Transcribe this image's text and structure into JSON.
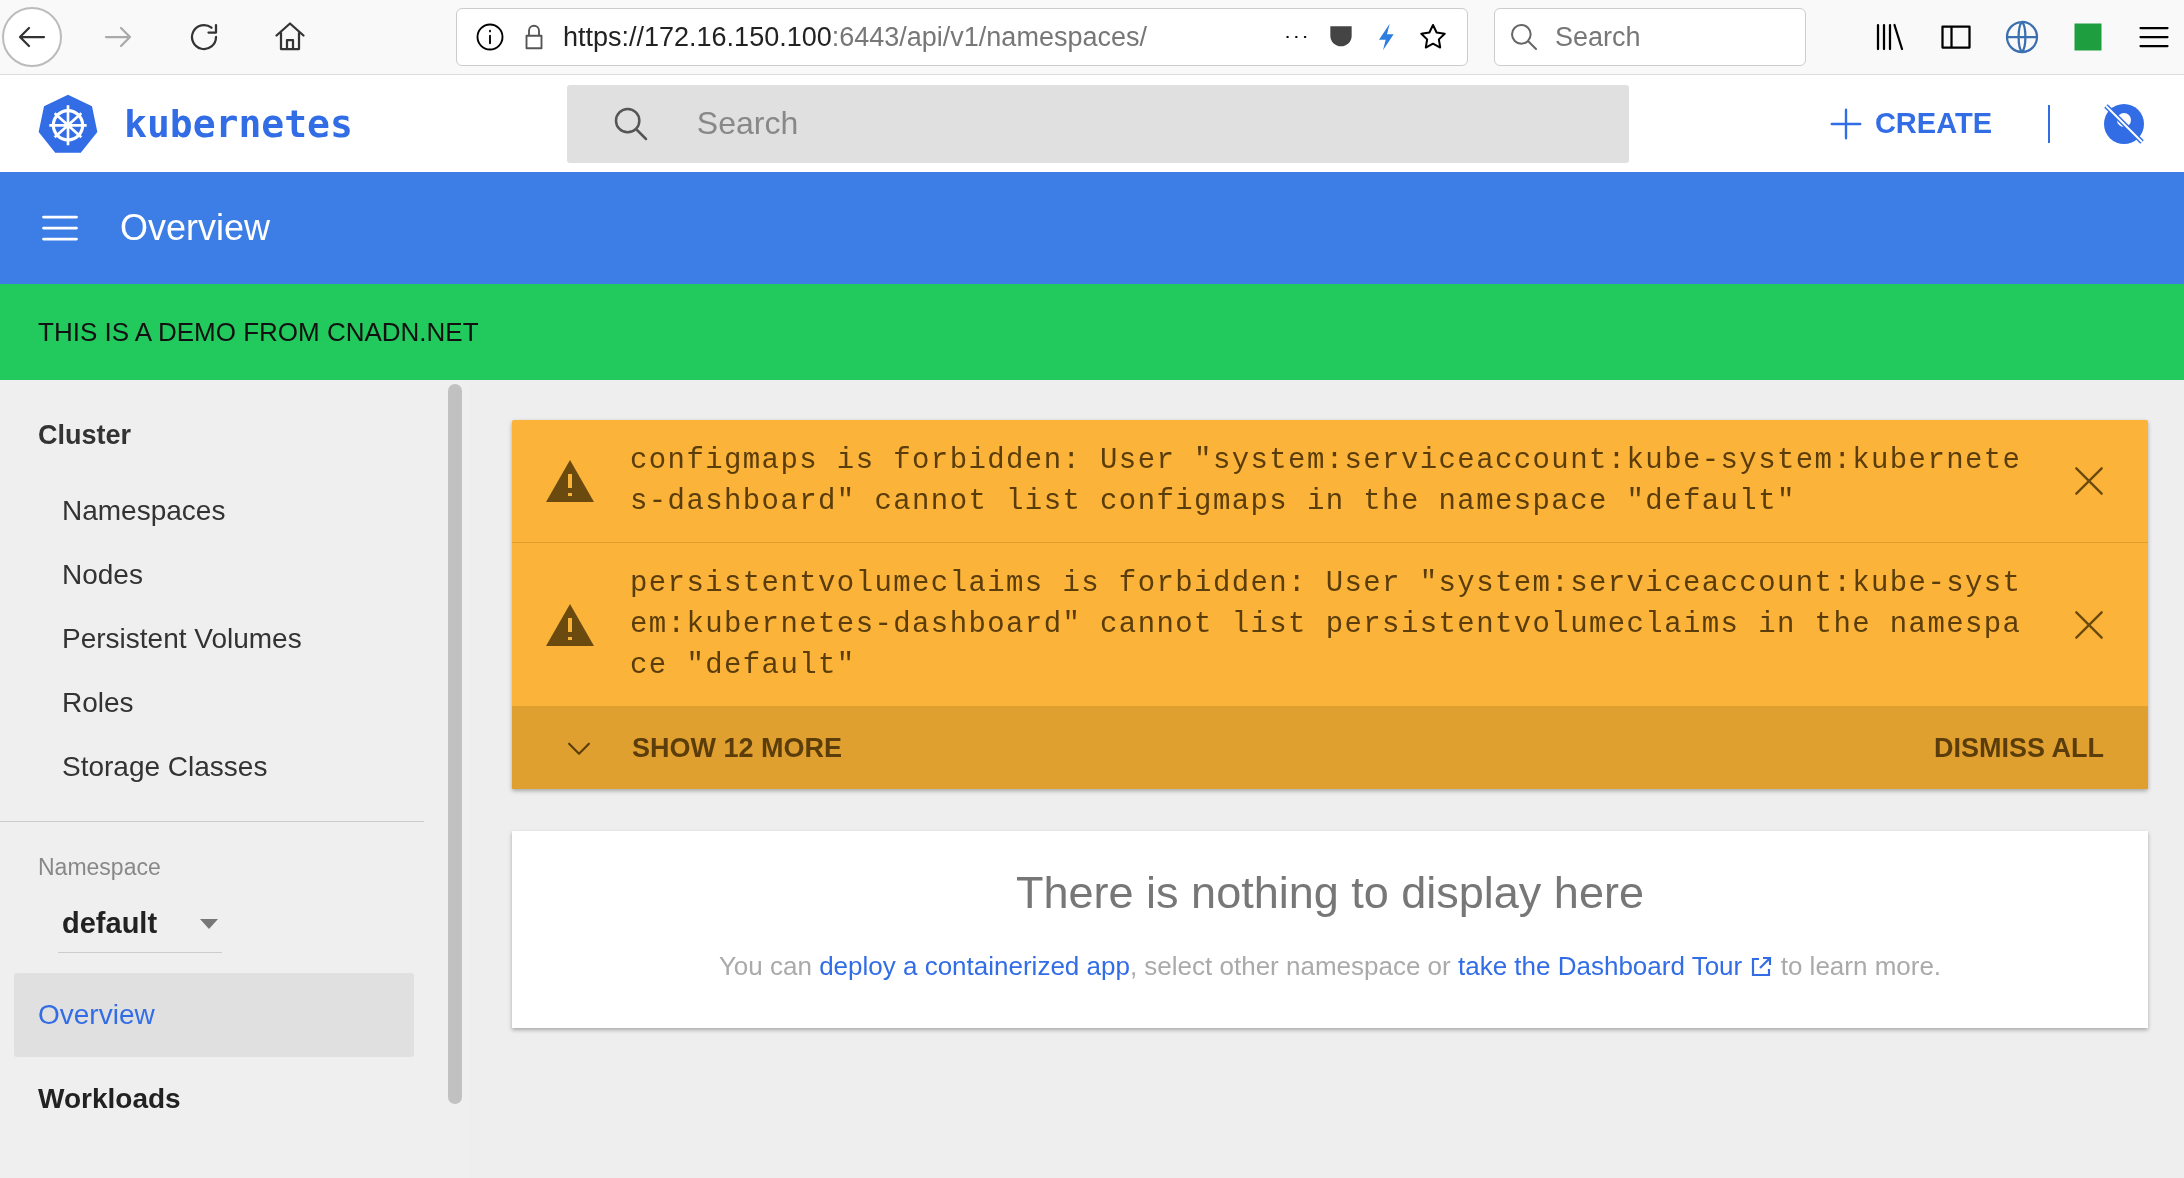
{
  "browser": {
    "url_host": "https://172.16.150.100",
    "url_rest": ":6443/api/v1/namespaces/",
    "search": {
      "placeholder": "Search"
    }
  },
  "header": {
    "brand": "kubernetes",
    "search": {
      "placeholder": "Search"
    },
    "create": "CREATE"
  },
  "title_bar": {
    "title": "Overview"
  },
  "banner": "THIS IS A DEMO FROM CNADN.NET",
  "sidebar": {
    "sections": [
      {
        "title": "Cluster",
        "items": [
          {
            "label": "Namespaces"
          },
          {
            "label": "Nodes"
          },
          {
            "label": "Persistent Volumes"
          },
          {
            "label": "Roles"
          },
          {
            "label": "Storage Classes"
          }
        ]
      }
    ],
    "namespace": {
      "label": "Namespace",
      "value": "default"
    },
    "nav": [
      {
        "label": "Overview",
        "selected": true
      },
      {
        "label": "Workloads",
        "selected": false
      }
    ]
  },
  "alerts": {
    "items": [
      {
        "message": "configmaps is forbidden: User \"system:serviceaccount:kube-system:kubernetes-dashboard\" cannot list configmaps in the namespace \"default\""
      },
      {
        "message": "persistentvolumeclaims is forbidden: User \"system:serviceaccount:kube-system:kubernetes-dashboard\" cannot list persistentvolumeclaims in the namespace \"default\""
      }
    ],
    "show_more": "SHOW 12 MORE",
    "dismiss_all": "DISMISS ALL"
  },
  "empty": {
    "title": "There is nothing to display here",
    "parts": [
      {
        "kind": "text",
        "text": "You can "
      },
      {
        "kind": "link",
        "text": "deploy a containerized app"
      },
      {
        "kind": "text",
        "text": ", select other namespace or "
      },
      {
        "kind": "external_link",
        "text": "take the Dashboard Tour"
      },
      {
        "kind": "text",
        "text": " to learn more."
      }
    ]
  }
}
